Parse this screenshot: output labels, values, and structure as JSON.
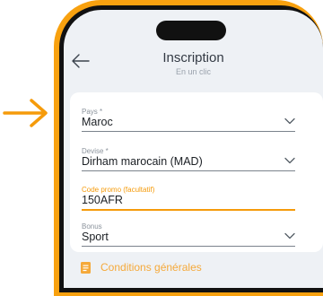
{
  "header": {
    "title": "Inscription",
    "subtitle": "En un clic"
  },
  "form": {
    "country": {
      "label": "Pays *",
      "value": "Maroc"
    },
    "currency": {
      "label": "Devise *",
      "value": "Dirham marocain (MAD)"
    },
    "promo": {
      "label": "Code promo (facultatif)",
      "value": "150AFR"
    },
    "bonus": {
      "label": "Bonus",
      "value": "Sport"
    }
  },
  "conditions": {
    "label": "Conditions générales"
  },
  "colors": {
    "accent": "#f59b0b",
    "frame": "#f8a10f",
    "screen_background": "#eef1f5",
    "card_background": "#ffffff",
    "text_primary": "#1b1f24",
    "text_label": "#8b939c"
  },
  "icons": {
    "pointer": "pointer-arrow-icon",
    "back": "back-arrow-icon",
    "dropdown": "chevron-down-icon",
    "conditions": "document-icon"
  }
}
